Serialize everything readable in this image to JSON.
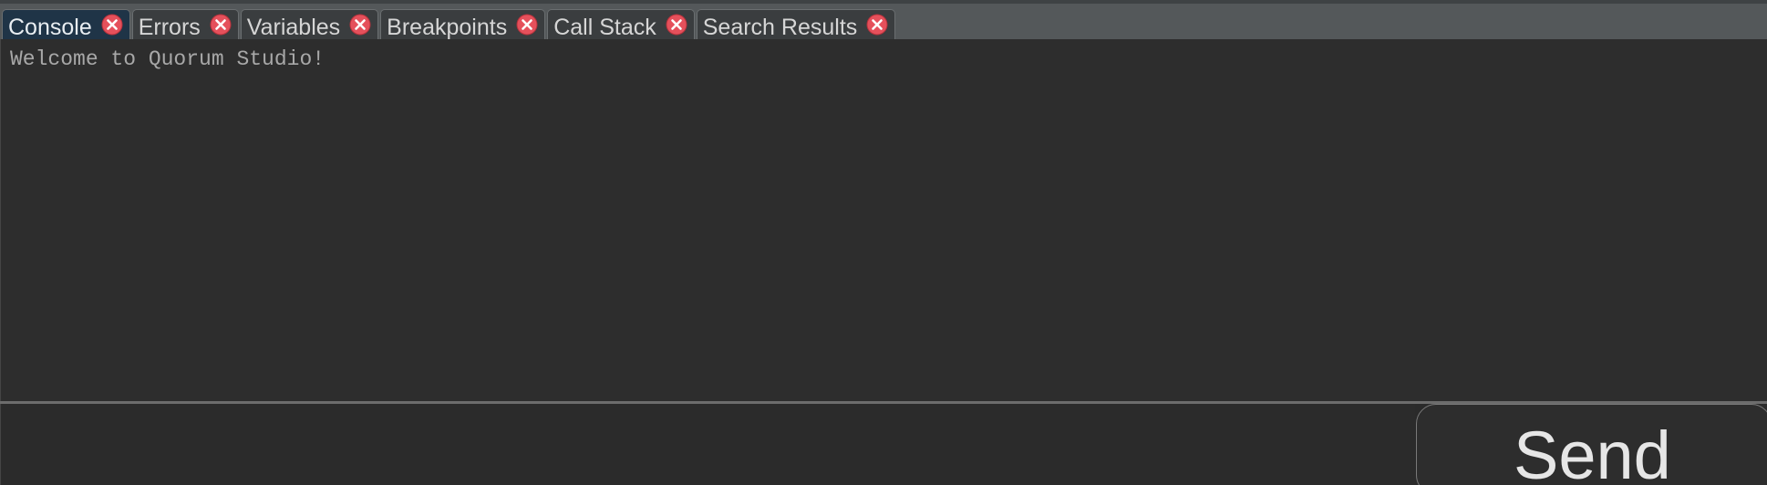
{
  "panel": {
    "tabs": [
      {
        "label": "Console",
        "active": true,
        "close_icon": "close-circle-icon"
      },
      {
        "label": "Errors",
        "active": false,
        "close_icon": "close-circle-icon"
      },
      {
        "label": "Variables",
        "active": false,
        "close_icon": "close-circle-icon"
      },
      {
        "label": "Breakpoints",
        "active": false,
        "close_icon": "close-circle-icon"
      },
      {
        "label": "Call Stack",
        "active": false,
        "close_icon": "close-circle-icon"
      },
      {
        "label": "Search Results",
        "active": false,
        "close_icon": "close-circle-icon"
      }
    ]
  },
  "console": {
    "output_text": "Welcome to Quorum Studio!",
    "input_value": "",
    "send_label": "Send"
  },
  "colors": {
    "tab_strip": "#54585a",
    "active_tab": "#1f3447",
    "close_icon_fill": "#e5505b",
    "background": "#2c2c2c"
  }
}
